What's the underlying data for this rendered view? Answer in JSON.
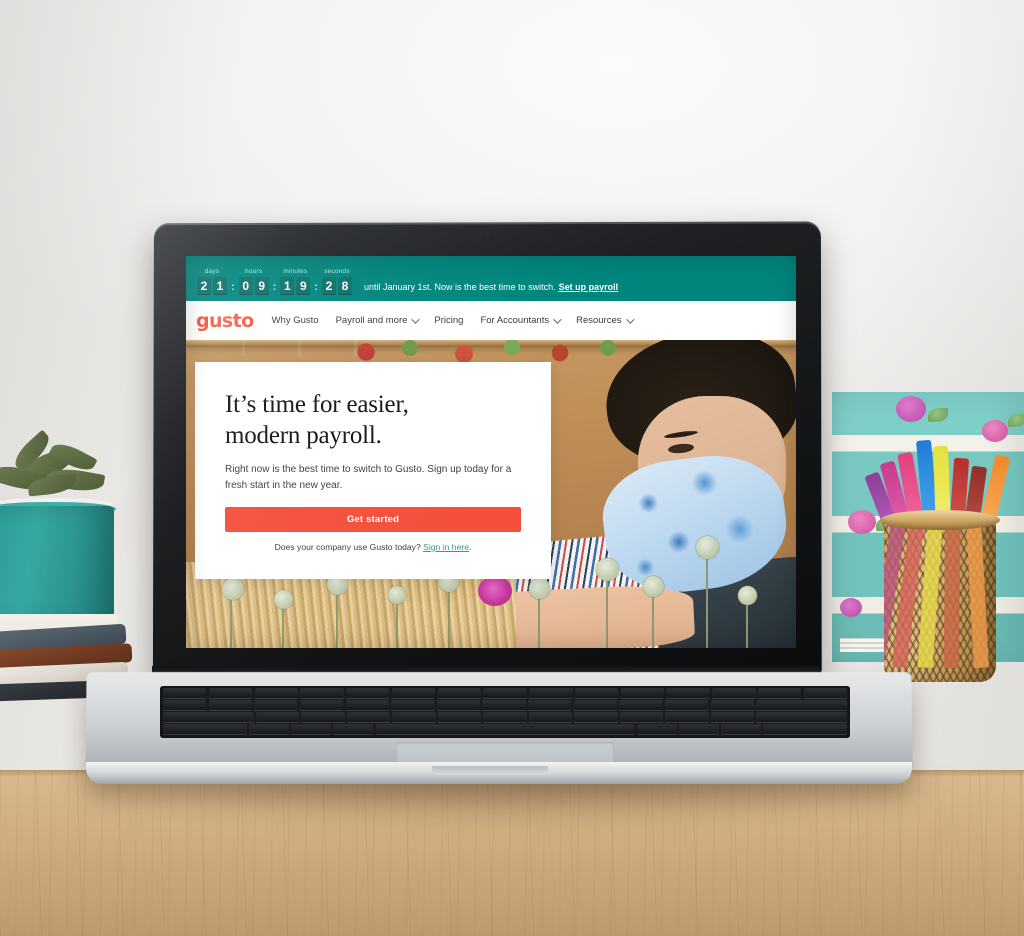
{
  "scene": {
    "description": "laptop-on-desk-mockup",
    "objects": {
      "succulent_label": "succulent-in-teal-pot",
      "books_label": "stacked-books",
      "pencup_label": "gold-mesh-pen-cup",
      "panel_label": "teal-floral-panel",
      "desk_label": "wooden-desk"
    }
  },
  "colors": {
    "banner_teal": "#00857d",
    "banner_digit_bg": "#0b6f69",
    "cta_coral": "#f4503c",
    "logo_coral": "#f04b2e",
    "link_teal": "#2f9b8f",
    "laptop_silver": "#c2c6ca",
    "laptop_bezel": "#131416"
  },
  "site": {
    "banner": {
      "countdown": [
        {
          "label": "days",
          "digits": [
            "2",
            "1"
          ]
        },
        {
          "label": "hours",
          "digits": [
            "0",
            "9"
          ]
        },
        {
          "label": "minutes",
          "digits": [
            "1",
            "9"
          ]
        },
        {
          "label": "seconds",
          "digits": [
            "2",
            "8"
          ]
        }
      ],
      "separator": ":",
      "message": "until January 1st. Now is the best time to switch.",
      "link_label": "Set up payroll"
    },
    "nav": {
      "logo": "gusto",
      "items": [
        {
          "label": "Why Gusto",
          "has_dropdown": false
        },
        {
          "label": "Payroll and more",
          "has_dropdown": true
        },
        {
          "label": "Pricing",
          "has_dropdown": false
        },
        {
          "label": "For Accountants",
          "has_dropdown": true
        },
        {
          "label": "Resources",
          "has_dropdown": true
        }
      ]
    },
    "hero": {
      "heading_line1": "It’s time for easier,",
      "heading_line2": "modern payroll.",
      "subtext": "Right now is the best time to switch to Gusto. Sign up today for a fresh start in the new year.",
      "cta_label": "Get started",
      "signin_prefix": "Does your company use Gusto today? ",
      "signin_link": "Sign in here",
      "signin_suffix": ".",
      "photo_alt": "florist wearing blue tie-dye mask arranging dried flowers"
    }
  }
}
